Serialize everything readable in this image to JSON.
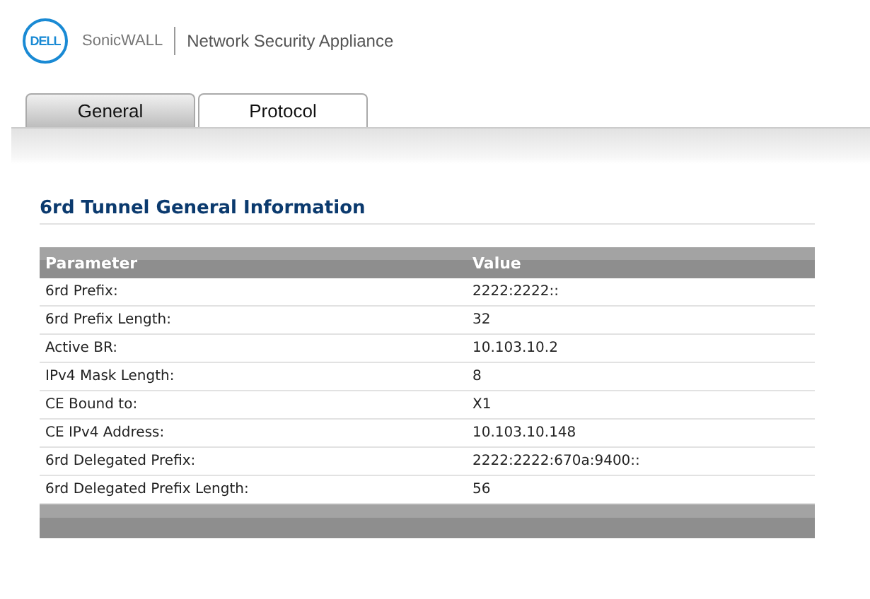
{
  "header": {
    "logo_text": "DELL",
    "product": "SonicWALL",
    "subtitle": "Network Security Appliance"
  },
  "tabs": [
    {
      "label": "General",
      "selected": false
    },
    {
      "label": "Protocol",
      "selected": true
    }
  ],
  "section": {
    "title": "6rd Tunnel General Information"
  },
  "table": {
    "columns": [
      "Parameter",
      "Value"
    ],
    "rows": [
      [
        "6rd Prefix:",
        "2222:2222::"
      ],
      [
        "6rd Prefix Length:",
        "32"
      ],
      [
        "Active BR:",
        "10.103.10.2"
      ],
      [
        "IPv4 Mask Length:",
        "8"
      ],
      [
        "CE Bound to:",
        "X1"
      ],
      [
        "CE IPv4 Address:",
        "10.103.10.148"
      ],
      [
        "6rd Delegated Prefix:",
        "2222:2222:670a:9400::"
      ],
      [
        "6rd Delegated Prefix Length:",
        "56"
      ]
    ]
  }
}
